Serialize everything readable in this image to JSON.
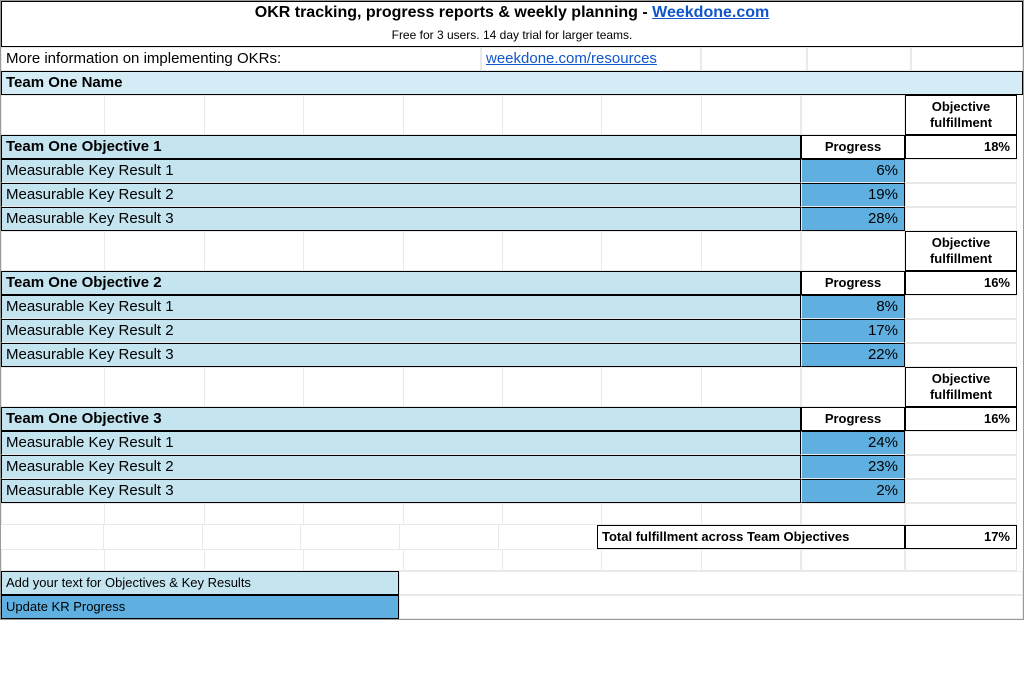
{
  "header": {
    "title_prefix": "OKR tracking, progress reports & weekly planning - ",
    "title_link": "Weekdone.com",
    "subtitle": "Free for 3 users. 14 day trial for larger teams.",
    "info_label": "More information on implementing OKRs:",
    "info_link": "weekdone.com/resources"
  },
  "team_name": "Team One Name",
  "labels": {
    "progress": "Progress",
    "objective_fulfillment": "Objective fulfillment",
    "total_fulfillment": "Total fulfillment across Team Objectives",
    "legend_add": "Add your text for Objectives & Key Results",
    "legend_update": "Update KR Progress"
  },
  "objectives": [
    {
      "name": "Team One Objective 1",
      "fulfillment": "18%",
      "krs": [
        {
          "name": "Measurable Key Result 1",
          "progress": "6%"
        },
        {
          "name": "Measurable Key Result 2",
          "progress": "19%"
        },
        {
          "name": "Measurable Key Result 3",
          "progress": "28%"
        }
      ]
    },
    {
      "name": "Team One Objective 2",
      "fulfillment": "16%",
      "krs": [
        {
          "name": "Measurable Key Result 1",
          "progress": "8%"
        },
        {
          "name": "Measurable Key Result 2",
          "progress": "17%"
        },
        {
          "name": "Measurable Key Result 3",
          "progress": "22%"
        }
      ]
    },
    {
      "name": "Team One Objective 3",
      "fulfillment": "16%",
      "krs": [
        {
          "name": "Measurable Key Result 1",
          "progress": "24%"
        },
        {
          "name": "Measurable Key Result 2",
          "progress": "23%"
        },
        {
          "name": "Measurable Key Result 3",
          "progress": "2%"
        }
      ]
    }
  ],
  "total_fulfillment": "17%"
}
